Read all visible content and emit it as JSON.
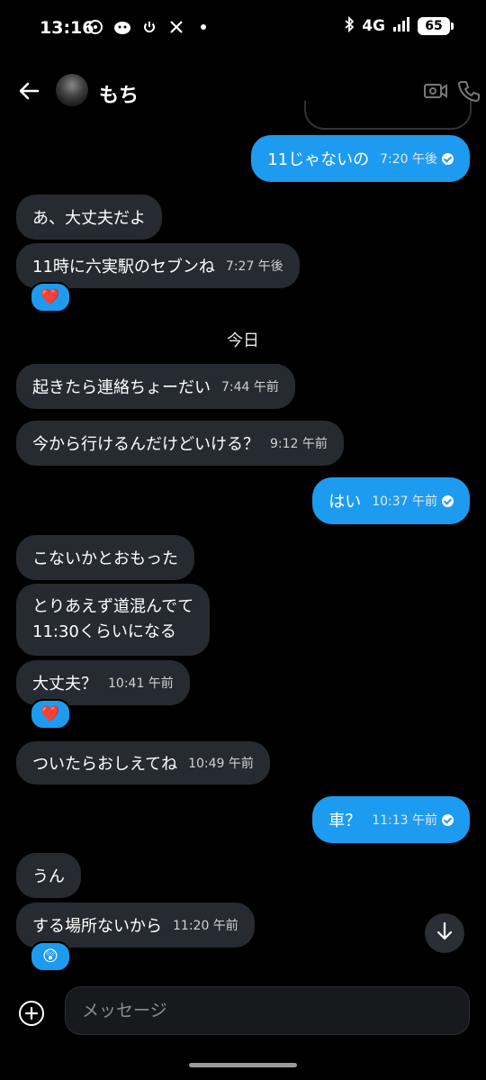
{
  "status_bar": {
    "time": "13:16",
    "network": "4G",
    "battery": "65"
  },
  "header": {
    "contact_name": "もち"
  },
  "day_divider": "今日",
  "messages": [
    {
      "text": "11じゃないの",
      "time": "7:20 午後",
      "dir": "out"
    },
    {
      "text": "あ、大丈夫だよ",
      "time": "",
      "dir": "in"
    },
    {
      "text": "11時に六実駅のセブンね",
      "time": "7:27 午後",
      "dir": "in"
    },
    {
      "text": "起きたら連絡ちょーだい",
      "time": "7:44 午前",
      "dir": "in"
    },
    {
      "text": "今から行けるんだけどいける？",
      "time": "9:12 午前",
      "dir": "in"
    },
    {
      "text": "はい",
      "time": "10:37 午前",
      "dir": "out"
    },
    {
      "text": "こないかとおもった",
      "time": "",
      "dir": "in"
    },
    {
      "text": "とりあえず道混んでて",
      "text2": "11:30くらいになる",
      "time": "",
      "dir": "in"
    },
    {
      "text": "大丈夫？",
      "time": "10:41 午前",
      "dir": "in"
    },
    {
      "text": "ついたらおしえてね",
      "time": "10:49 午前",
      "dir": "in"
    },
    {
      "text": "車？",
      "time": "11:13 午前",
      "dir": "out"
    },
    {
      "text": "うん",
      "time": "",
      "dir": "in"
    },
    {
      "text": "する場所ないから",
      "time": "11:20 午前",
      "dir": "in"
    }
  ],
  "reactions": {
    "r1": "❤️",
    "r2": "❤️",
    "r3": "😲"
  },
  "composer": {
    "placeholder": "メッセージ"
  },
  "colors": {
    "accent": "#1d9bf0",
    "incoming_bubble": "#262b31",
    "background": "#000000"
  }
}
